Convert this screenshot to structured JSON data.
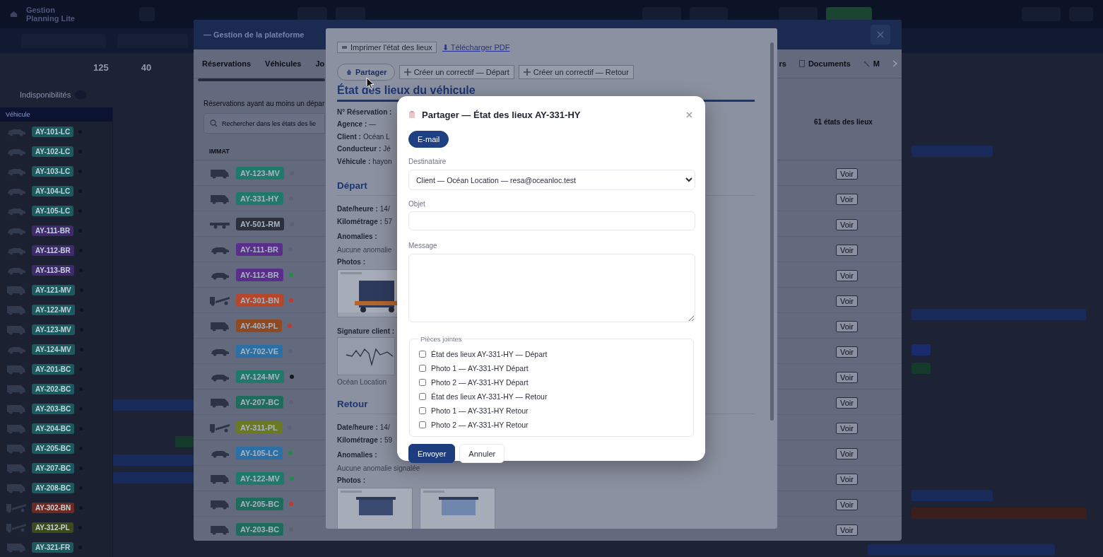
{
  "app": {
    "title": "Gestion Planning Lite",
    "stats": [
      {
        "value": "125"
      },
      {
        "value": "40"
      }
    ],
    "unavailability": {
      "label": "Indisponibilités"
    },
    "vehicle_column": "Véhicule",
    "vehicles": [
      {
        "plate": "AY-101-LC",
        "kind": "car",
        "color": "#1b5a5e"
      },
      {
        "plate": "AY-102-LC",
        "kind": "car",
        "color": "#1b5a5e"
      },
      {
        "plate": "AY-103-LC",
        "kind": "car",
        "color": "#1b5a5e"
      },
      {
        "plate": "AY-104-LC",
        "kind": "car",
        "color": "#1b5a5e"
      },
      {
        "plate": "AY-105-LC",
        "kind": "car",
        "color": "#1b5a5e"
      },
      {
        "plate": "AY-111-BR",
        "kind": "car",
        "color": "#3f2a6b"
      },
      {
        "plate": "AY-112-BR",
        "kind": "car",
        "color": "#3f2a6b"
      },
      {
        "plate": "AY-113-BR",
        "kind": "car",
        "color": "#3f2a6b"
      },
      {
        "plate": "AY-121-MV",
        "kind": "van",
        "color": "#1b5a5e"
      },
      {
        "plate": "AY-122-MV",
        "kind": "van",
        "color": "#1b5a5e"
      },
      {
        "plate": "AY-123-MV",
        "kind": "van",
        "color": "#1b5a5e"
      },
      {
        "plate": "AY-124-MV",
        "kind": "car",
        "color": "#1b5a5e"
      },
      {
        "plate": "AY-201-BC",
        "kind": "van",
        "color": "#1b5a5e"
      },
      {
        "plate": "AY-202-BC",
        "kind": "van",
        "color": "#1b5a5e"
      },
      {
        "plate": "AY-203-BC",
        "kind": "van",
        "color": "#1b5a5e"
      },
      {
        "plate": "AY-204-BC",
        "kind": "van",
        "color": "#1b5a5e"
      },
      {
        "plate": "AY-205-BC",
        "kind": "van",
        "color": "#1b5a5e"
      },
      {
        "plate": "AY-207-BC",
        "kind": "van",
        "color": "#1b5a5e"
      },
      {
        "plate": "AY-208-BC",
        "kind": "van",
        "color": "#1b5a5e"
      },
      {
        "plate": "AY-302-BN",
        "kind": "truck",
        "color": "#6e2a22"
      },
      {
        "plate": "AY-312-PL",
        "kind": "truck",
        "color": "#3f4a1c"
      },
      {
        "plate": "AY-321-FR",
        "kind": "van",
        "color": "#1b5a5e"
      }
    ]
  },
  "platform": {
    "title": "— Gestion de la plateforme",
    "tabs_left": [
      {
        "label": "Réservations",
        "selected": false
      },
      {
        "label": "Véhicules",
        "selected": false
      },
      {
        "label": "Jo",
        "selected": false
      }
    ],
    "tabs_right": [
      {
        "label": "rs",
        "selected": false
      },
      {
        "label": "Documents",
        "selected": false
      },
      {
        "label": "M",
        "selected": false
      }
    ],
    "description": "Réservations ayant au moins un dépar",
    "search": {
      "placeholder": "Rechercher dans les états des lie"
    },
    "count": "61 états des lieux",
    "column_1": "IMMAT",
    "rows": [
      {
        "plate": "AY-123-MV",
        "kind": "van",
        "color": "#1f7a6b",
        "status_dot": {
          "color": "#5c6272"
        },
        "action": "Voir"
      },
      {
        "plate": "AY-331-HY",
        "kind": "van",
        "color": "#1f7a6b",
        "status_dot": {
          "color": "#5c6272"
        },
        "action": "Voir"
      },
      {
        "plate": "AY-501-RM",
        "kind": "trailer",
        "color": "#2b303c",
        "status_dot": {
          "color": "#5c6272"
        },
        "action": "Voir"
      },
      {
        "plate": "AY-111-BR",
        "kind": "car",
        "color": "#5a2f8c",
        "status_dot": {
          "color": "#5c6272"
        },
        "action": "Voir"
      },
      {
        "plate": "AY-112-BR",
        "kind": "car",
        "color": "#5a2f8c",
        "status_dot": {
          "color": "#1f8a4a"
        },
        "action": "Voir"
      },
      {
        "plate": "AY-301-BN",
        "kind": "truck",
        "color": "#b5472a",
        "status_dot": {
          "color": "#c0392b"
        },
        "action": "Voir"
      },
      {
        "plate": "AY-403-PL",
        "kind": "van",
        "color": "#8e4a22",
        "status_dot": {
          "color": "#c0392b"
        },
        "action": "Voir"
      },
      {
        "plate": "AY-702-VE",
        "kind": "car",
        "color": "#2a6fa5",
        "status_dot": {
          "color": "#5c6272"
        },
        "action": "Voir"
      },
      {
        "plate": "AY-124-MV",
        "kind": "car",
        "color": "#1f7a6b",
        "status_dot": {
          "color": "#15171c"
        },
        "action": "Voir"
      },
      {
        "plate": "AY-207-BC",
        "kind": "van",
        "color": "#1f6b5c",
        "status_dot": {
          "color": "#5c6272"
        },
        "action": "Voir"
      },
      {
        "plate": "AY-311-PL",
        "kind": "truck",
        "color": "#6b7a22",
        "status_dot": {
          "color": "#5c6272"
        },
        "action": "Voir"
      },
      {
        "plate": "AY-105-LC",
        "kind": "car",
        "color": "#2a6fa5",
        "status_dot": {
          "color": "#1f8a4a"
        },
        "action": "Voir"
      },
      {
        "plate": "AY-122-MV",
        "kind": "van",
        "color": "#1f7a6b",
        "status_dot": {
          "color": "#1f8a4a"
        },
        "action": "Voir"
      },
      {
        "plate": "AY-205-BC",
        "kind": "van",
        "color": "#1f6b5c",
        "status_dot": {
          "color": "#c0392b"
        },
        "action": "Voir"
      },
      {
        "plate": "AY-203-BC",
        "kind": "van",
        "color": "#1f6b5c",
        "status_dot": {
          "color": "#5c6272"
        },
        "action": "Voir"
      }
    ]
  },
  "inspection": {
    "print_button": "Imprimer l'état des lieux",
    "pdf_link": "⬇ Télécharger PDF",
    "share_button": "Partager",
    "fix_buttons": [
      "Créer un correctif — Départ",
      "Créer un correctif — Retour"
    ],
    "heading": "État des lieux du véhicule",
    "info": [
      {
        "label": "N° Réservation :"
      },
      {
        "text": "**Agence :** —"
      },
      {
        "label": "Client :",
        "value": "Océan L"
      },
      {
        "label": "Conducteur :",
        "value": "Jé"
      },
      {
        "label": "Véhicule :",
        "value": "hayon"
      }
    ],
    "sections": [
      {
        "title": "Départ",
        "lines": [
          {
            "label": "Date/heure :",
            "value": "14/"
          },
          {
            "label": "Kilométrage :",
            "value": "57"
          }
        ],
        "anomalies_label": "Anomalies :",
        "anomalies": "Aucune anomalie",
        "photos_label": "Photos :",
        "photos": [
          {
            "kind": "picture"
          }
        ],
        "signature_label": "Signature client :",
        "signature_name": "Océan Location"
      },
      {
        "title": "Retour",
        "lines": [
          {
            "label": "Date/heure :",
            "value": "14/"
          },
          {
            "label": "Kilométrage :",
            "value": "59"
          }
        ],
        "anomalies_label": "Anomalies :",
        "anomalies": "Aucune anomalie signalée",
        "photos_label": "Photos :",
        "photos": [
          {
            "kind": "picture"
          },
          {
            "kind": "picture"
          }
        ]
      }
    ]
  },
  "share": {
    "title": "Partager — État des lieux AY-331-HY",
    "channels": [
      {
        "label": "E-mail",
        "selected": true
      }
    ],
    "recipient": {
      "label": "Destinataire",
      "value": "Client — Océan Location — resa@oceanloc.test"
    },
    "subject": {
      "label": "Objet"
    },
    "message": {
      "label": "Message"
    },
    "attachments": {
      "legend": "Pièces jointes",
      "items": [
        {
          "label": "État des lieux AY-331-HY — Départ",
          "checked": false
        },
        {
          "label": "Photo 1 — AY-331-HY Départ",
          "checked": false
        },
        {
          "label": "Photo 2 — AY-331-HY Départ",
          "checked": false
        },
        {
          "label": "État des lieux AY-331-HY — Retour",
          "checked": false
        },
        {
          "label": "Photo 1 — AY-331-HY Retour",
          "checked": false
        },
        {
          "label": "Photo 2 — AY-331-HY Retour",
          "checked": false
        }
      ]
    },
    "buttons": [
      {
        "label": "Envoyer",
        "kind": "primary"
      },
      {
        "label": "Annuler",
        "kind": "secondary"
      }
    ]
  }
}
